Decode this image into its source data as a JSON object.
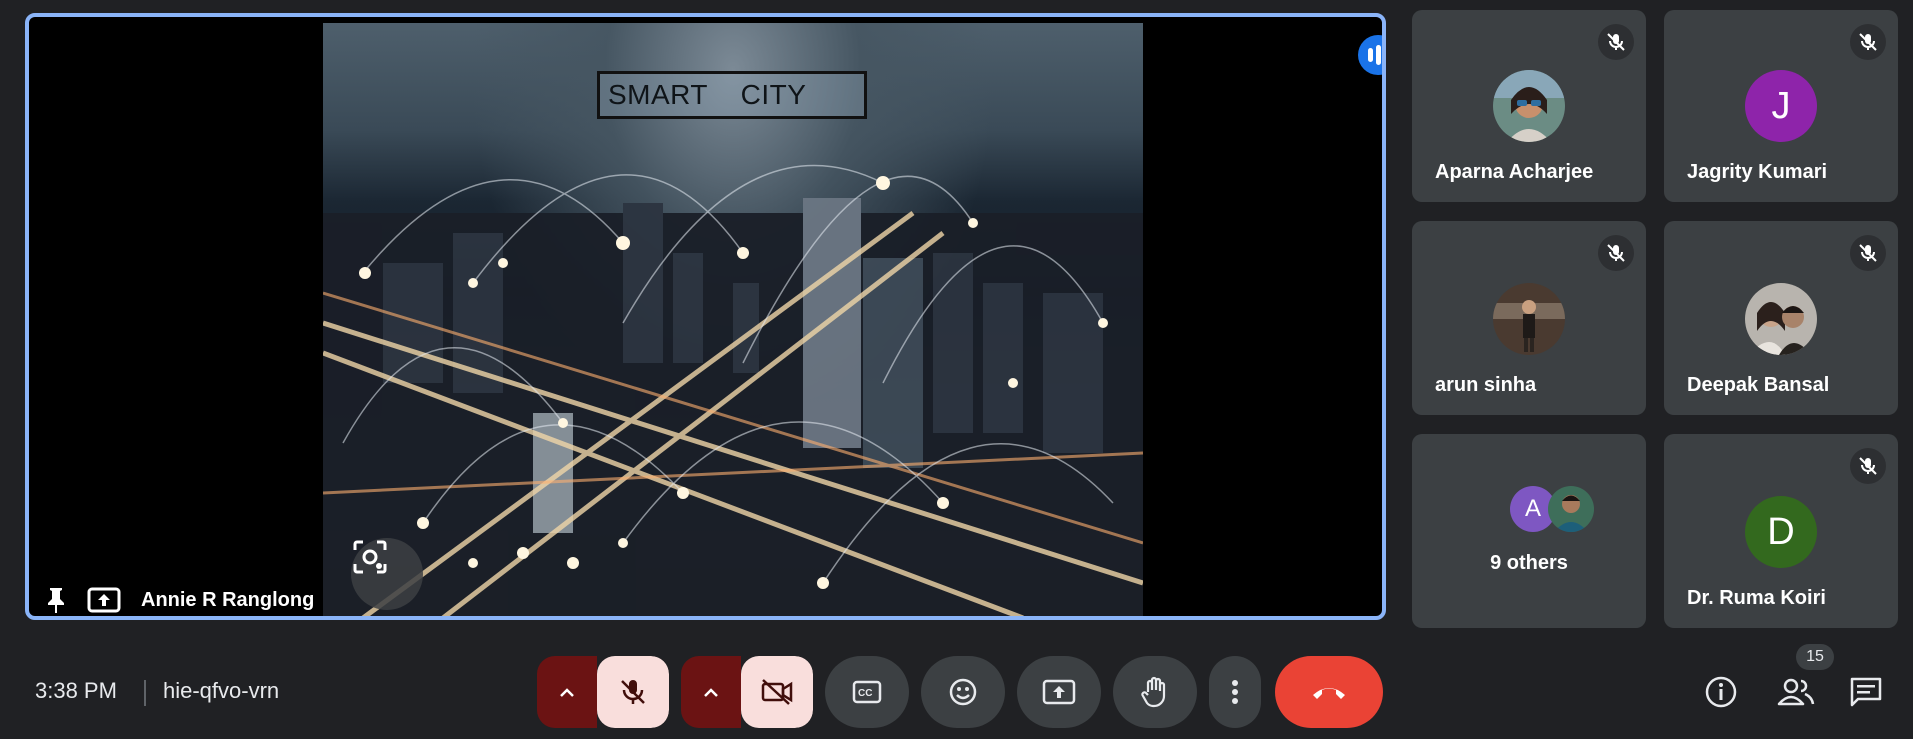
{
  "presentation": {
    "slide_title": "SMART    CITY",
    "presenter_name": "Annie R Ranglong",
    "speaking_indicator": "audio-level-icon"
  },
  "participants": [
    {
      "name": "Aparna Acharjee",
      "muted": true,
      "avatar": "photo",
      "avatar_color": "#6a8a7a"
    },
    {
      "name": "Jagrity Kumari",
      "muted": true,
      "avatar": "J",
      "avatar_color": "#8e24aa"
    },
    {
      "name": "arun sinha",
      "muted": true,
      "avatar": "photo",
      "avatar_color": "#4a3a30"
    },
    {
      "name": "Deepak Bansal",
      "muted": true,
      "avatar": "photo",
      "avatar_color": "#9a9a9a"
    },
    {
      "name": "9 others",
      "muted": false,
      "avatar": "A",
      "avatar_color": "#7e57c2"
    },
    {
      "name": "Dr. Ruma Koiri",
      "muted": true,
      "avatar": "D",
      "avatar_color": "#33691e"
    }
  ],
  "footer": {
    "time": "3:38 PM",
    "meeting_code": "hie-qfvo-vrn",
    "people_count": "15"
  },
  "controls": [
    "mic-off-icon",
    "camera-off-icon",
    "captions-icon",
    "emoji-icon",
    "present-icon",
    "raise-hand-icon",
    "more-options-icon",
    "end-call-icon"
  ],
  "colors": {
    "accent": "#8ab4f8",
    "danger": "#ea4335",
    "muted_bg": "#f9dedc",
    "muted_caret": "#6b1313",
    "surface": "#3c4043",
    "background": "#202124"
  }
}
